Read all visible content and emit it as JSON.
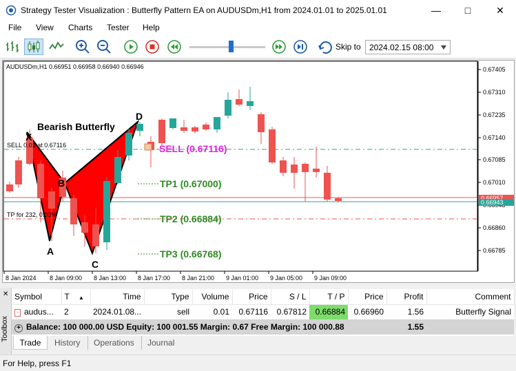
{
  "window": {
    "title": "Strategy Tester Visualization : Butterfly Pattern EA on AUDUSDm,H1 from 2024.01.01 to 2025.01.01"
  },
  "menu": [
    "File",
    "View",
    "Charts",
    "Tester",
    "Help"
  ],
  "toolbar": {
    "skip_label": "Skip to",
    "skip_date": "2024.02.15 08:00"
  },
  "chart": {
    "symbol_info": "AUDUSDm,H1  0.66951 0.66958 0.66940 0.66946",
    "pattern_title": "Bearish Butterfly",
    "points": [
      "X",
      "A",
      "B",
      "C",
      "D"
    ],
    "sell_label": "SELL (0.67116)",
    "tp1_label": "TP1 (0.67000)",
    "tp2_label": "TP2 (0.66884)",
    "tp3_label": "TP3 (0.66768)",
    "sell_line_label": "SELL 0.01 at 0.67116",
    "tp_line_label": "TP for 232, 0.03%",
    "price_ticks": [
      "0.67405",
      "0.67310",
      "0.67235",
      "0.67140",
      "0.67085",
      "0.67010",
      "0.66943",
      "0.66860",
      "0.66785"
    ],
    "current_price": "0.66943",
    "bid_price": "0.66957",
    "time_ticks": [
      "8 Jan 2024",
      "8 Jan 09:00",
      "8 Jan 13:00",
      "8 Jan 17:00",
      "8 Jan 21:00",
      "9 Jan 01:00",
      "9 Jan 05:00",
      "9 Jan 09:00"
    ],
    "colors": {
      "bull": "#26a69a",
      "bear": "#ef5350",
      "pattern_fill": "#ff0000",
      "sell_text": "#e020e0",
      "tp_text": "#2e8b22"
    }
  },
  "trades": {
    "headers": [
      "Symbol",
      "T",
      "Time",
      "Type",
      "Volume",
      "Price",
      "S / L",
      "T / P",
      "Price",
      "Profit",
      "Comment"
    ],
    "rows": [
      [
        "audus...",
        "2",
        "2024.01.08...",
        "sell",
        "0.01",
        "0.67116",
        "0.67812",
        "0.66884",
        "0.66960",
        "1.56",
        "Butterfly Signal"
      ]
    ],
    "balance_text": "Balance: 100 000.00 USD  Equity: 100 001.55  Margin: 0.67  Free Margin: 100 000.88",
    "balance_profit": "1.55"
  },
  "tabs": [
    "Trade",
    "History",
    "Operations",
    "Journal"
  ],
  "toolbox_label": "Toolbox",
  "status": "For Help, press F1"
}
